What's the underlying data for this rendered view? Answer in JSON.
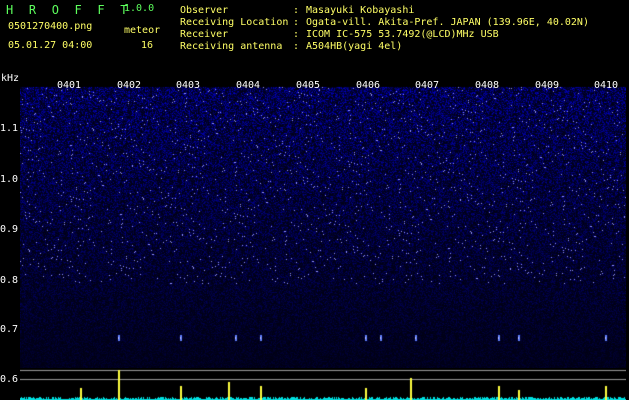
{
  "header": {
    "title": "H R O F F T",
    "version": "1.0.0",
    "filename": "0501270400.png",
    "meteor_label": "meteor",
    "meteor_count": "16",
    "datetime": "05.01.27 04:00"
  },
  "info": [
    {
      "key": "Observer",
      "value": "Masayuki Kobayashi"
    },
    {
      "key": "Receiving Location",
      "value": "Ogata-vill. Akita-Pref. JAPAN (139.96E, 40.02N)"
    },
    {
      "key": "Receiver",
      "value": "ICOM IC-575 53.7492(@LCD)MHz USB"
    },
    {
      "key": "Receiving antenna",
      "value": "A504HB(yagi 4el)"
    }
  ],
  "spectrogram": {
    "y_unit": "kHz",
    "y_ticks": [
      "1.1",
      "1.0",
      "0.9",
      "0.8",
      "0.7",
      "0.6"
    ],
    "x_ticks": [
      "0401",
      "0402",
      "0403",
      "0404",
      "0405",
      "0406",
      "0407",
      "0408",
      "0409",
      "0410"
    ],
    "colors": {
      "background": "#000000",
      "noise": "#2a2aa0",
      "axis_text": "#ffffff",
      "level": "#00e0e0",
      "peak": "#ffff40"
    }
  }
}
